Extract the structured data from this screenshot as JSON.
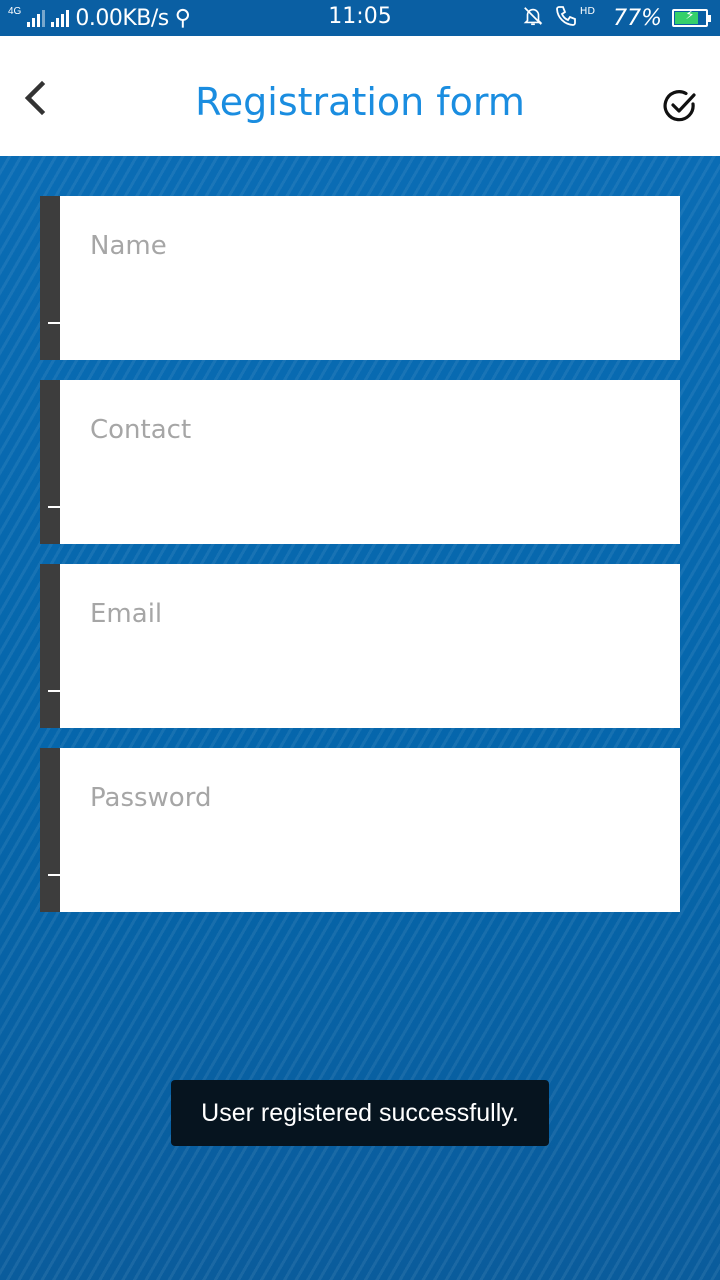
{
  "status_bar": {
    "network_type": "4G",
    "net_speed": "0.00KB/s",
    "time": "11:05",
    "hd_badge": "HD",
    "battery_percent": "77%",
    "battery_level": 0.77,
    "battery_color": "#35d06a",
    "icons": [
      "signal-icon",
      "usb-icon",
      "silent-icon",
      "call-hd-icon",
      "battery-icon"
    ]
  },
  "toolbar": {
    "title": "Registration form",
    "title_color": "#1a8de0",
    "back_icon": "chevron-left-icon",
    "confirm_icon": "check-circle-icon"
  },
  "form": {
    "fields": [
      {
        "placeholder": "Name",
        "value": ""
      },
      {
        "placeholder": "Contact",
        "value": ""
      },
      {
        "placeholder": "Email",
        "value": ""
      },
      {
        "placeholder": "Password",
        "value": ""
      }
    ]
  },
  "toast": {
    "message": "User registered successfully."
  },
  "colors": {
    "background": "#0566ab",
    "field_accent": "#3d3d3d",
    "toast_bg": "#06141f"
  }
}
